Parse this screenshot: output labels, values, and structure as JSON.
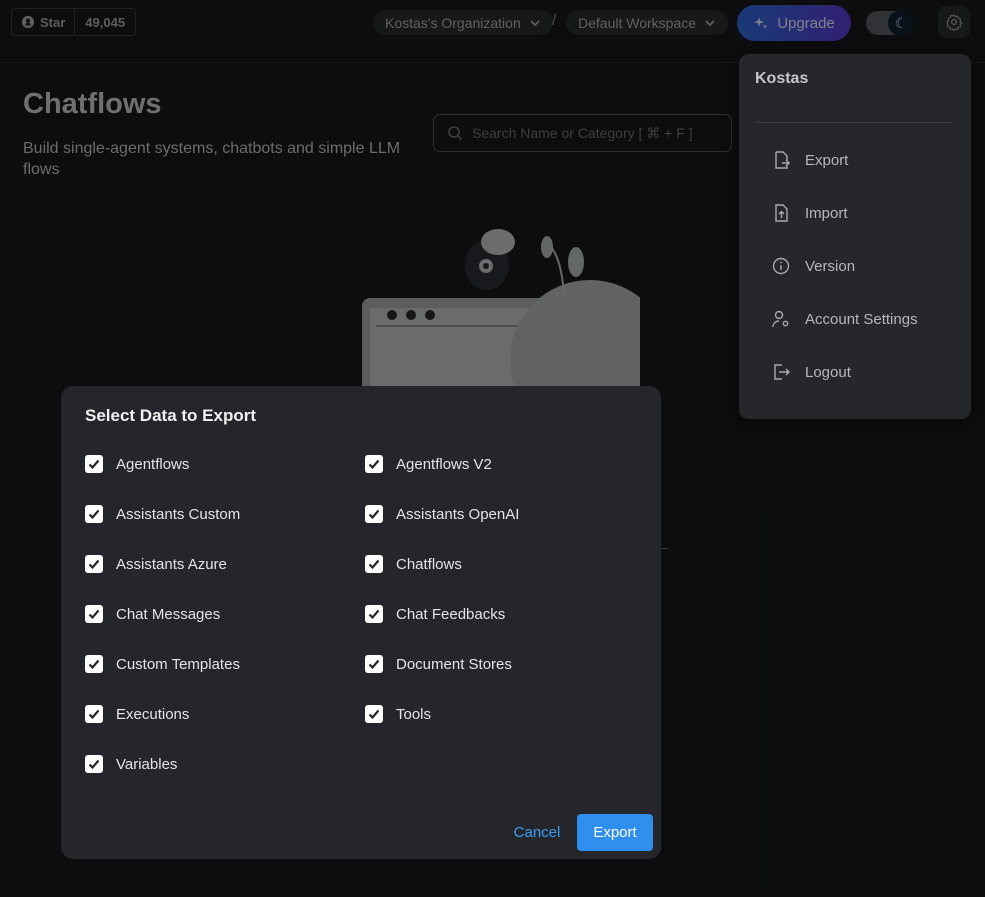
{
  "github": {
    "star_label": "Star",
    "count": "49,045"
  },
  "header": {
    "organization": "Kostas's Organization",
    "separator": "/",
    "workspace": "Default Workspace",
    "upgrade_label": "Upgrade"
  },
  "page": {
    "title": "Chatflows",
    "subtitle": "Build single-agent systems, chatbots and simple LLM flows",
    "search_placeholder": "Search Name or Category [ ⌘ + F ]"
  },
  "settings_menu": {
    "user": "Kostas",
    "items": [
      {
        "label": "Export",
        "icon": "file-export-icon"
      },
      {
        "label": "Import",
        "icon": "file-upload-icon"
      },
      {
        "label": "Version",
        "icon": "info-icon"
      },
      {
        "label": "Account Settings",
        "icon": "user-settings-icon"
      },
      {
        "label": "Logout",
        "icon": "logout-icon"
      }
    ]
  },
  "export_dialog": {
    "title": "Select Data to Export",
    "options": [
      {
        "label": "Agentflows",
        "checked": true
      },
      {
        "label": "Agentflows V2",
        "checked": true
      },
      {
        "label": "Assistants Custom",
        "checked": true
      },
      {
        "label": "Assistants OpenAI",
        "checked": true
      },
      {
        "label": "Assistants Azure",
        "checked": true
      },
      {
        "label": "Chatflows",
        "checked": true
      },
      {
        "label": "Chat Messages",
        "checked": true
      },
      {
        "label": "Chat Feedbacks",
        "checked": true
      },
      {
        "label": "Custom Templates",
        "checked": true
      },
      {
        "label": "Document Stores",
        "checked": true
      },
      {
        "label": "Executions",
        "checked": true
      },
      {
        "label": "Tools",
        "checked": true
      },
      {
        "label": "Variables",
        "checked": true
      }
    ],
    "cancel_label": "Cancel",
    "export_label": "Export"
  },
  "colors": {
    "accent": "#2f8fef",
    "upgrade_gradient_start": "#2d6ad8",
    "upgrade_gradient_end": "#5b3ad0"
  }
}
